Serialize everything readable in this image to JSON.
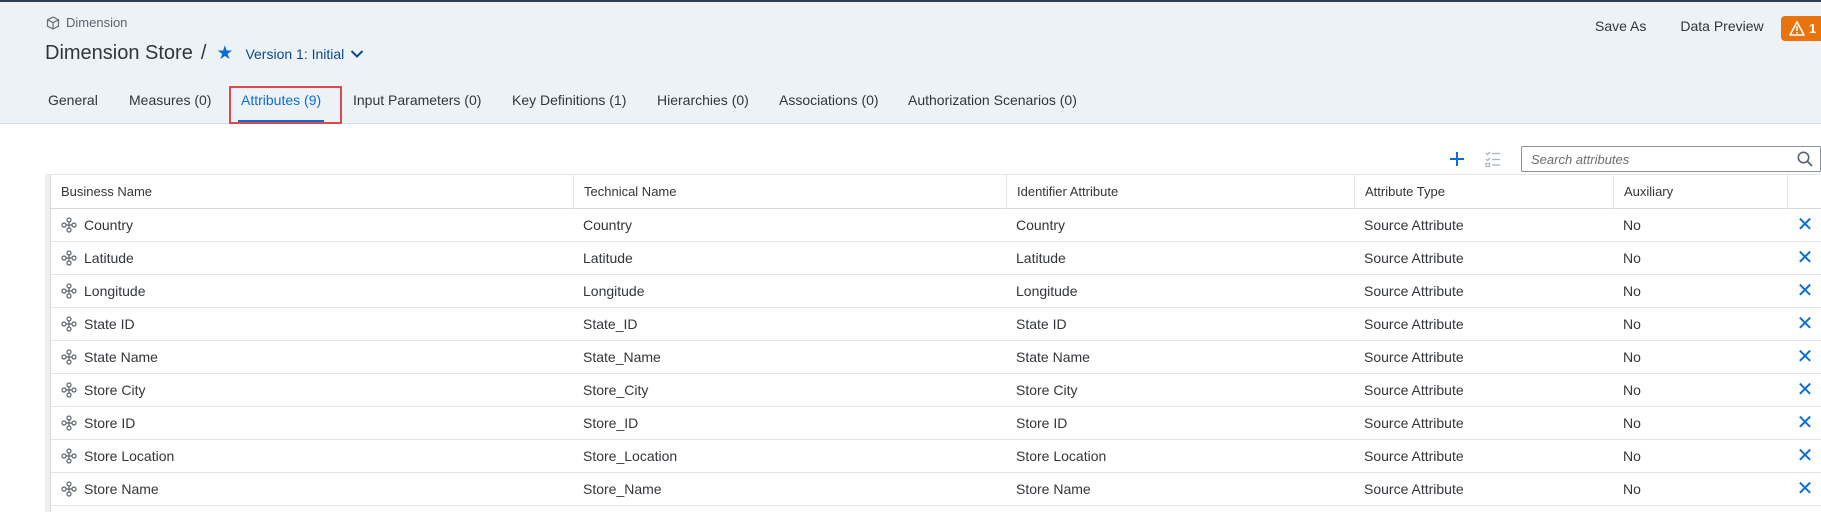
{
  "header": {
    "object_type": "Dimension",
    "title": "Dimension Store",
    "separator": "/",
    "version_label": "Version 1: Initial",
    "actions": [
      "Save As",
      "Data Preview"
    ],
    "warning_count": "1"
  },
  "tabs": [
    {
      "label": "General"
    },
    {
      "label": "Measures (0)"
    },
    {
      "label": "Attributes (9)"
    },
    {
      "label": "Input Parameters (0)"
    },
    {
      "label": "Key Definitions (1)"
    },
    {
      "label": "Hierarchies (0)"
    },
    {
      "label": "Associations (0)"
    },
    {
      "label": "Authorization Scenarios (0)"
    }
  ],
  "selected_tab": "Attributes (9)",
  "search": {
    "placeholder": "Search attributes"
  },
  "table": {
    "columns": [
      "Business Name",
      "Technical Name",
      "Identifier Attribute",
      "Attribute Type",
      "Auxiliary"
    ],
    "rows": [
      [
        "Country",
        "Country",
        "Country",
        "Source Attribute",
        "No"
      ],
      [
        "Latitude",
        "Latitude",
        "Latitude",
        "Source Attribute",
        "No"
      ],
      [
        "Longitude",
        "Longitude",
        "Longitude",
        "Source Attribute",
        "No"
      ],
      [
        "State ID",
        "State_ID",
        "State ID",
        "Source Attribute",
        "No"
      ],
      [
        "State Name",
        "State_Name",
        "State Name",
        "Source Attribute",
        "No"
      ],
      [
        "Store City",
        "Store_City",
        "Store City",
        "Source Attribute",
        "No"
      ],
      [
        "Store ID",
        "Store_ID",
        "Store ID",
        "Source Attribute",
        "No"
      ],
      [
        "Store Location",
        "Store_Location",
        "Store Location",
        "Source Attribute",
        "No"
      ],
      [
        "Store Name",
        "Store_Name",
        "Store Name",
        "Source Attribute",
        "No"
      ]
    ]
  },
  "colors": {
    "accent": "#0a6ed1",
    "warning": "#e9730c",
    "highlight": "#e0474c",
    "header_bg": "#edf2f7"
  }
}
